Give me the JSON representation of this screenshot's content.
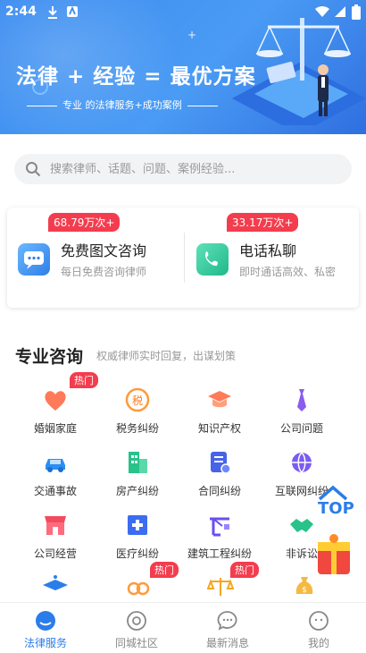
{
  "status_bar": {
    "time": "2:44"
  },
  "banner": {
    "title": "法律 + 经验 = 最优方案",
    "subtitle": "专业 的法律服务+成功案例"
  },
  "search": {
    "placeholder": "搜索律师、话题、问题、案例经验..."
  },
  "consult": {
    "free": {
      "badge": "68.79万次+",
      "title": "免费图文咨询",
      "desc": "每日免费咨询律师"
    },
    "phone": {
      "badge": "33.17万次+",
      "title": "电话私聊",
      "desc": "即时通话高效、私密"
    }
  },
  "section": {
    "title": "专业咨询",
    "subtitle": "权威律师实时回复，出谋划策"
  },
  "categories": [
    {
      "label": "婚姻家庭",
      "hot": "热门"
    },
    {
      "label": "税务纠纷"
    },
    {
      "label": "知识产权"
    },
    {
      "label": "公司问题"
    },
    {
      "label": "交通事故"
    },
    {
      "label": "房产纠纷"
    },
    {
      "label": "合同纠纷"
    },
    {
      "label": "互联网纠纷"
    },
    {
      "label": "公司经营"
    },
    {
      "label": "医疗纠纷"
    },
    {
      "label": "建筑工程纠纷"
    },
    {
      "label": "非诉讼"
    }
  ],
  "partial_row_hot": [
    "热门",
    "热门"
  ],
  "top_button": {
    "label": "TOP"
  },
  "bottom_nav": [
    {
      "label": "法律服务",
      "icon": "law-service-icon",
      "active": true
    },
    {
      "label": "同城社区",
      "icon": "community-icon"
    },
    {
      "label": "最新消息",
      "icon": "message-icon"
    },
    {
      "label": "我的",
      "icon": "profile-icon"
    }
  ],
  "colors": {
    "accent": "#2b7de9",
    "hot": "#f33d4e",
    "banner": "#3b8cf0"
  }
}
